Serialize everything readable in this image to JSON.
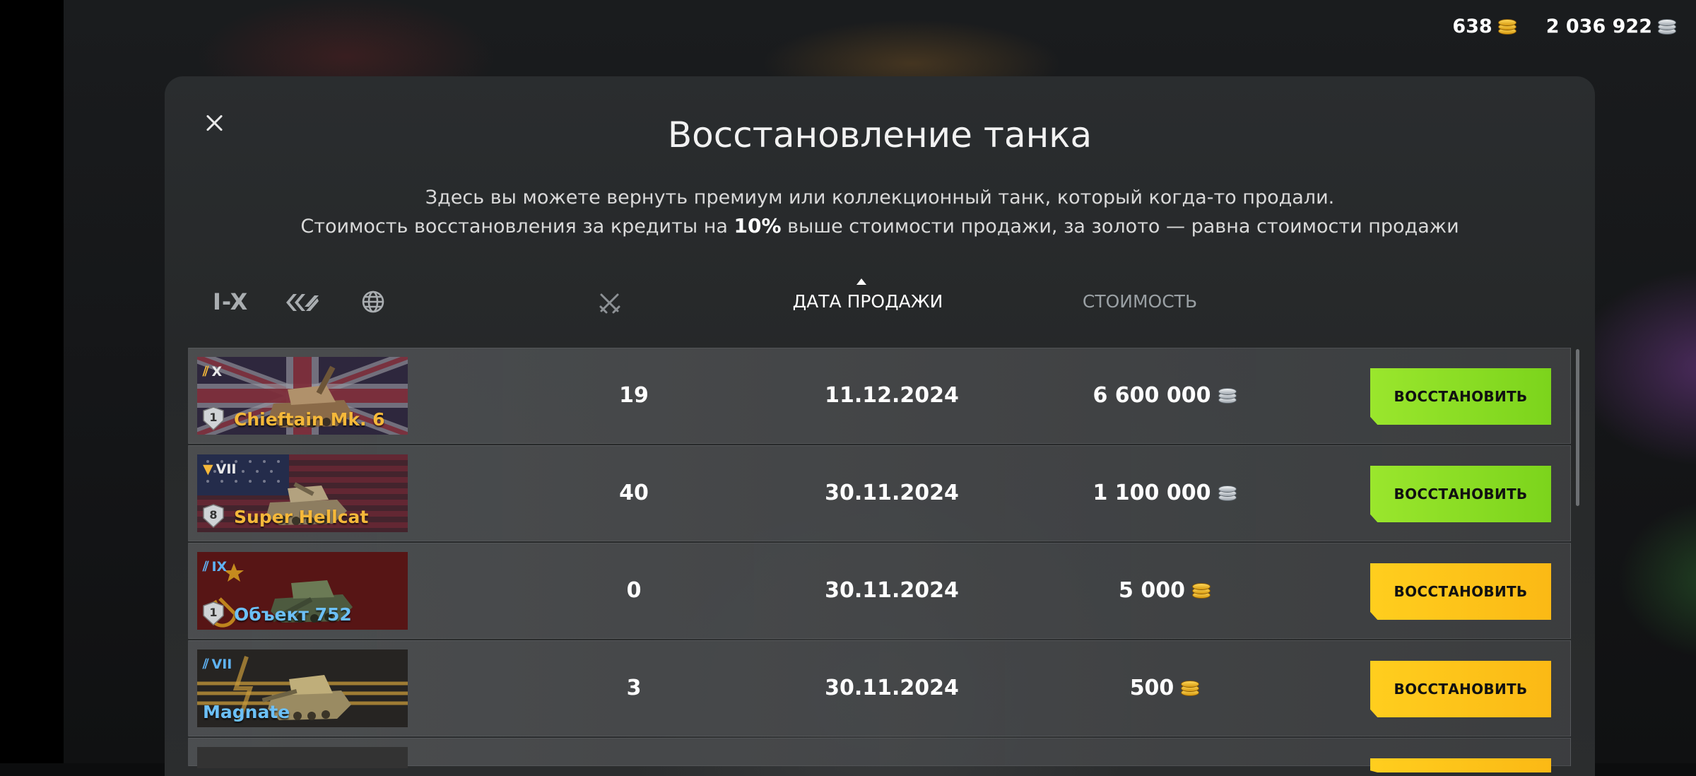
{
  "currency": {
    "gold": "638",
    "credits": "2 036 922"
  },
  "modal": {
    "title": "Восстановление танка",
    "desc_line1": "Здесь вы можете вернуть премиум или коллекционный танк, который когда-то продали.",
    "desc_line2_pre": "Стоимость восстановления за кредиты на ",
    "desc_line2_bold": "10%",
    "desc_line2_post": " выше стоимости продажи, за золото — равна стоимости продажи"
  },
  "header": {
    "tier_filter": "I-X",
    "col_date": "ДАТА ПРОДАЖИ",
    "col_cost": "СТОИМОСТЬ"
  },
  "rows": [
    {
      "tier": "X",
      "name": "Chieftain Mk. 6",
      "level": "1",
      "battles": "19",
      "date": "11.12.2024",
      "cost": "6 600 000",
      "currency": "silver",
      "button": "ВОССТАНОВИТЬ",
      "button_color": "#8edc25"
    },
    {
      "tier": "VII",
      "name": "Super Hellcat",
      "level": "8",
      "battles": "40",
      "date": "30.11.2024",
      "cost": "1 100 000",
      "currency": "silver",
      "button": "ВОССТАНОВИТЬ",
      "button_color": "#8edc25"
    },
    {
      "tier": "IX",
      "name": "Объект 752",
      "level": "1",
      "battles": "0",
      "date": "30.11.2024",
      "cost": "5 000",
      "currency": "gold",
      "button": "ВОССТАНОВИТЬ",
      "button_color": "#fdc41a"
    },
    {
      "tier": "VII",
      "name": "Magnate",
      "battles": "3",
      "date": "30.11.2024",
      "cost": "500",
      "currency": "gold",
      "button": "ВОССТАНОВИТЬ",
      "button_color": "#fdc41a"
    }
  ]
}
